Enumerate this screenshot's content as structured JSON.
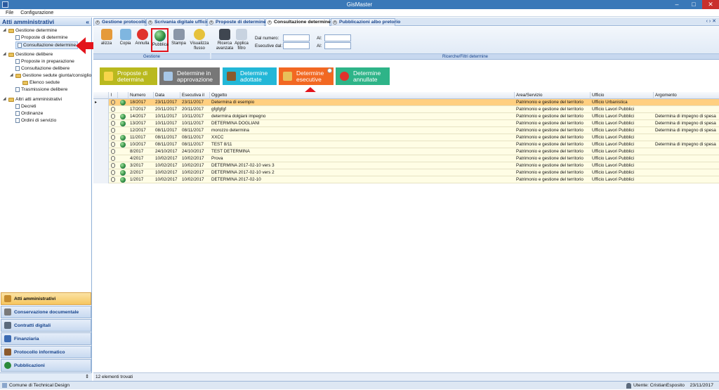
{
  "app": {
    "title": "GisMaster"
  },
  "menu": {
    "file": "File",
    "config": "Configurazione"
  },
  "left": {
    "title": "Atti amministrativi",
    "tree": {
      "gest_det": "Gestione determine",
      "proposte_det": "Proposte di determine",
      "consultazione_det": "Consultazione determine",
      "gest_del": "Gestione delibere",
      "proposte_prep": "Proposte in preparazione",
      "consultazione_del": "Consultazione delibere",
      "sedute": "Gestione sedute giunta/consiglio",
      "elenco_sedute": "Elenco sedute",
      "trasmissione": "Trasmissione delibere",
      "altri": "Altri atti amministrativi",
      "decreti": "Decreti",
      "ordinanze": "Ordinanze",
      "ordini": "Ordini di servizio"
    },
    "nav": [
      "Atti amministrativi",
      "Conservazione documentale",
      "Contratti digitali",
      "Finanziaria",
      "Protocollo informatico",
      "Pubblicazioni"
    ]
  },
  "tabs": [
    "Gestione protocollo",
    "Scrivania digitale ufficio",
    "Proposte di determine",
    "Consultazione determine",
    "Pubblicazioni albo pretorio"
  ],
  "ribbon": {
    "buttons": [
      "alizza",
      "Copia",
      "Annulla",
      "Pubblica",
      "Stampa",
      "Visualizza flusso",
      "Ricerca avanzata",
      "Applica filtro"
    ],
    "dal_numero": "Dal numero:",
    "esecutive_dal": "Esecutive dal:",
    "al": "Al:",
    "group_gestione": "Gestione",
    "group_ricerche": "Ricerche/Filtri determine"
  },
  "big_buttons": [
    {
      "label": "Proposte di determina",
      "color": "#b9b91e"
    },
    {
      "label": "Determine in approvazione",
      "color": "#777777"
    },
    {
      "label": "Determine adottate",
      "color": "#22b7d7"
    },
    {
      "label": "Determine esecutive",
      "color": "#f26822"
    },
    {
      "label": "Determine annullate",
      "color": "#2eb488"
    }
  ],
  "grid": {
    "columns": [
      "Numero",
      "Data",
      "Esecutiva il",
      "Oggetto",
      "Area/Servizio",
      "Ufficio",
      "Argomento"
    ],
    "rows": [
      [
        "18/2017",
        "23/11/2017",
        "23/11/2017",
        "Determina di esempio",
        "Patrimonio e gestione del territorio",
        "Ufficio Urbanistica",
        ""
      ],
      [
        "17/2017",
        "20/11/2017",
        "20/11/2017",
        "gfgfgfgf",
        "Patrimonio e gestione del territorio",
        "Ufficio Lavori Pubblici",
        ""
      ],
      [
        "14/2017",
        "10/11/2017",
        "10/11/2017",
        "determina dolgiani impegno",
        "Patrimonio e gestione del territorio",
        "Ufficio Lavori Pubblici",
        "Determina di impegno di spesa"
      ],
      [
        "13/2017",
        "10/11/2017",
        "10/11/2017",
        "DETERMINA DOGLIANI",
        "Patrimonio e gestione del territorio",
        "Ufficio Lavori Pubblici",
        "Determina di impegno di spesa"
      ],
      [
        "12/2017",
        "08/11/2017",
        "08/11/2017",
        "morozzo determina",
        "Patrimonio e gestione del territorio",
        "Ufficio Lavori Pubblici",
        "Determina di impegno di spesa"
      ],
      [
        "11/2017",
        "08/11/2017",
        "08/11/2017",
        "XXCC",
        "Patrimonio e gestione del territorio",
        "Ufficio Lavori Pubblici",
        ""
      ],
      [
        "10/2017",
        "08/11/2017",
        "08/11/2017",
        "TEST 8/11",
        "Patrimonio e gestione del territorio",
        "Ufficio Lavori Pubblici",
        "Determina di impegno di spesa"
      ],
      [
        "8/2017",
        "24/10/2017",
        "24/10/2017",
        "TEST DETERMINA",
        "Patrimonio e gestione del territorio",
        "Ufficio Lavori Pubblici",
        ""
      ],
      [
        "4/2017",
        "10/02/2017",
        "10/02/2017",
        "Prova",
        "Patrimonio e gestione del territorio",
        "Ufficio Lavori Pubblici",
        ""
      ],
      [
        "3/2017",
        "10/02/2017",
        "10/02/2017",
        "DETERMINA 2017-02-10 vers 3",
        "Patrimonio e gestione del territorio",
        "Ufficio Lavori Pubblici",
        ""
      ],
      [
        "2/2017",
        "10/02/2017",
        "10/02/2017",
        "DETERMINA 2017-02-10 vers 2",
        "Patrimonio e gestione del territorio",
        "Ufficio Lavori Pubblici",
        ""
      ],
      [
        "1/2017",
        "10/02/2017",
        "10/02/2017",
        "DETERMINA 2017-02-10",
        "Patrimonio e gestione del territorio",
        "Ufficio Lavori Pubblici",
        ""
      ]
    ],
    "footer": "12 elementi trovati"
  },
  "status": {
    "left": "Comune di Technical Design",
    "user": "Utente: CristianEsposito",
    "date": "23/11/2017"
  }
}
